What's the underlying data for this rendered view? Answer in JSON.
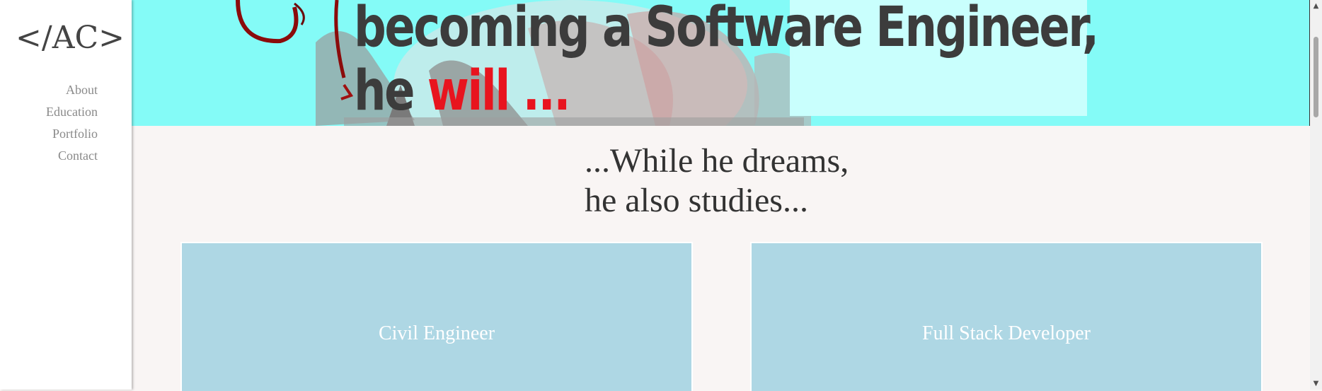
{
  "sidebar": {
    "logo": "</AC>",
    "nav": [
      "About",
      "Education",
      "Portfolio",
      "Contact"
    ]
  },
  "hero": {
    "line1": "becoming a Software Engineer,",
    "line2_prefix": "he ",
    "line2_highlight": "will ...",
    "colors": {
      "background": "#84fbf7",
      "highlight_text": "#e8141e",
      "text": "#3c3c3c"
    }
  },
  "main": {
    "heading_line1": "...While he dreams,",
    "heading_line2": "he also studies...",
    "cards": [
      "Civil Engineer",
      "Full Stack Developer"
    ],
    "card_color": "#aed7e4"
  },
  "scrollbar": {
    "up_icon": "chevron-up-icon",
    "down_icon": "chevron-down-icon"
  }
}
